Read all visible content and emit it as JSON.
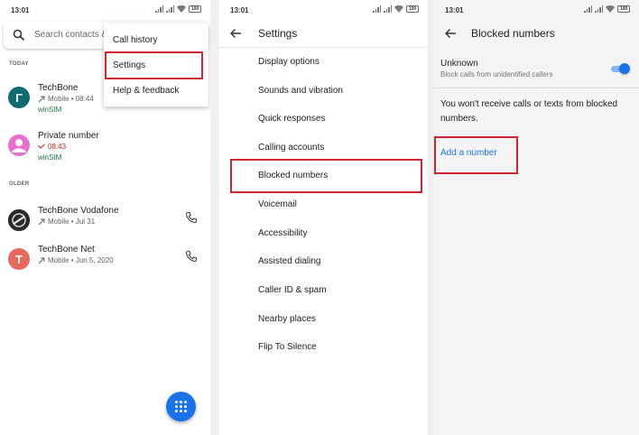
{
  "status_time": "13:01",
  "battery": "100",
  "colors": {
    "accent": "#1a73e8",
    "highlight": "#d0252f",
    "sim": "#188038",
    "missed": "#c5221f"
  },
  "dialer": {
    "search_placeholder": "Search contacts &",
    "section_today": "TODAY",
    "section_older": "OLDER",
    "calls": [
      {
        "name": "TechBone",
        "meta": "Mobile • 08:44",
        "sim": "winSIM",
        "avatar": "Γ",
        "avatar_color": "#0f6b70",
        "type": "outgoing"
      },
      {
        "name": "Private number",
        "meta": "08:43",
        "sim": "winSIM",
        "avatar": "",
        "avatar_color": "#e86fd0",
        "type": "missed"
      },
      {
        "name": "TechBone Vodafone",
        "meta": "Mobile • Jul 31",
        "avatar": "",
        "avatar_color": "#2b2b2b",
        "type": "outgoing"
      },
      {
        "name": "TechBone Net",
        "meta": "Mobile • Jun 5, 2020",
        "avatar": "T",
        "avatar_color": "#e8685d",
        "type": "outgoing"
      }
    ],
    "menu": [
      "Call history",
      "Settings",
      "Help & feedback"
    ],
    "fab_icon": "dialpad-icon"
  },
  "settings": {
    "title": "Settings",
    "items": [
      "Display options",
      "Sounds and vibration",
      "Quick responses",
      "Calling accounts",
      "Blocked numbers",
      "Voicemail",
      "Accessibility",
      "Assisted dialing",
      "Caller ID & spam",
      "Nearby places",
      "Flip To Silence"
    ]
  },
  "blocked": {
    "title": "Blocked numbers",
    "unknown_title": "Unknown",
    "unknown_sub": "Block calls from unidentified callers",
    "unknown_enabled": true,
    "note": "You won't receive calls or texts from blocked numbers.",
    "add_label": "Add a number"
  }
}
